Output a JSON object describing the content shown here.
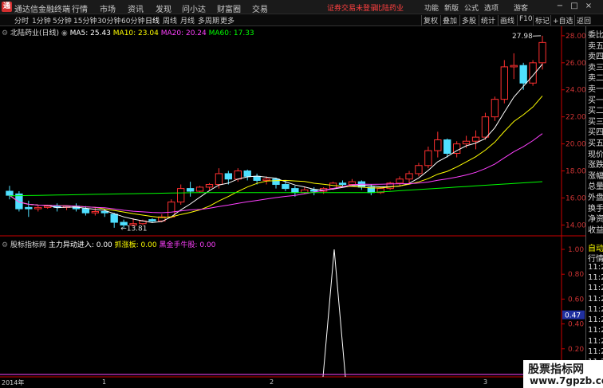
{
  "titlebar": {
    "logo": "通",
    "title": "通达信金融终端",
    "menus": [
      "行情",
      "市场",
      "资讯",
      "发现",
      "问小达",
      "财富圈",
      "交易"
    ],
    "notice": "证券交易未登录",
    "notice_stock": "北陆药业",
    "right_menus": [
      "功能",
      "新版",
      "公式",
      "选项"
    ],
    "user": "游客",
    "controls": [
      "−",
      "□",
      "×"
    ]
  },
  "toolbar": {
    "periods": [
      "分时",
      "1分钟",
      "5分钟",
      "15分钟",
      "30分钟",
      "60分钟",
      "日线",
      "周线",
      "月线",
      "多周期",
      "更多"
    ],
    "active_period": "日线",
    "buttons": [
      "复权",
      "叠加",
      "多股",
      "统计",
      "画线",
      "F10",
      "标记",
      "+自选",
      "返回"
    ]
  },
  "main": {
    "stock_label": "北陆药业(日线)",
    "ma5": "MA5: 25.43",
    "ma10": "MA10: 23.04",
    "ma20": "MA20: 20.24",
    "ma60": "MA60: 17.33",
    "high_label": "27.98",
    "low_label": "13.81"
  },
  "sub": {
    "indicator": "股标指标网",
    "line1": "主力异动进入: 0.00",
    "line2": "抓涨板: 0.00",
    "line3": "黑金手牛股: 0.00",
    "value_box": "0.47"
  },
  "right_panel": {
    "items": [
      "委比",
      "卖五",
      "卖四",
      "卖三",
      "卖二",
      "卖一",
      "买一",
      "买二",
      "买三",
      "买四",
      "买五",
      "现价",
      "涨跌",
      "涨幅",
      "总量",
      "外盘",
      "换手",
      "净资",
      "收益",
      "自动",
      "行情",
      "11:2",
      "11:2",
      "11:2",
      "11:2",
      "11:2",
      "11:2",
      "11:2",
      "11:2",
      "11:2",
      "11:2",
      "11:2",
      "11:2"
    ]
  },
  "chart_data": {
    "type": "candlestick",
    "price_axis": [
      "28.00",
      "26.00",
      "24.00",
      "22.00",
      "20.00",
      "18.00",
      "16.00",
      "14.00"
    ],
    "indicator_axis": [
      "1.00",
      "0.80",
      "0.60",
      "0.40",
      "0.20"
    ],
    "date_labels": [
      "2014年",
      "1",
      "2",
      "3"
    ],
    "colors": {
      "up": "#ff3030",
      "down": "#4fe0ff",
      "ma5": "#ffffff",
      "ma10": "#ffff00",
      "ma20": "#ff40ff",
      "ma60": "#00ff00"
    },
    "candles": [
      [
        16.5,
        16.9,
        16.2,
        15.9
      ],
      [
        16.3,
        16.5,
        15.2,
        15.0
      ],
      [
        15.3,
        15.8,
        15.2,
        14.6
      ],
      [
        15.2,
        15.5,
        15.3,
        15.0
      ],
      [
        15.3,
        15.5,
        15.4,
        15.2
      ],
      [
        15.4,
        15.6,
        15.3,
        15.0
      ],
      [
        15.3,
        15.4,
        15.4,
        15.1
      ],
      [
        15.4,
        15.6,
        15.2,
        15.0
      ],
      [
        15.2,
        15.4,
        14.9,
        14.7
      ],
      [
        14.9,
        15.3,
        15.0,
        14.7
      ],
      [
        15.0,
        15.2,
        14.9,
        14.6
      ],
      [
        14.8,
        14.9,
        14.2,
        13.8
      ],
      [
        14.2,
        14.4,
        14.0,
        13.8
      ],
      [
        14.0,
        14.5,
        14.1,
        13.9
      ],
      [
        14.1,
        14.4,
        14.3,
        14.0
      ],
      [
        14.4,
        14.5,
        14.3,
        14.2
      ],
      [
        14.3,
        14.8,
        14.6,
        14.2
      ],
      [
        14.6,
        15.9,
        15.7,
        14.5
      ],
      [
        15.7,
        17.0,
        16.7,
        15.5
      ],
      [
        16.7,
        17.2,
        16.5,
        16.1
      ],
      [
        16.5,
        16.9,
        16.8,
        16.4
      ],
      [
        16.8,
        17.1,
        17.0,
        16.6
      ],
      [
        17.0,
        18.2,
        17.8,
        16.7
      ],
      [
        17.8,
        18.0,
        17.4,
        17.0
      ],
      [
        17.4,
        18.2,
        18.0,
        17.2
      ],
      [
        18.0,
        18.1,
        17.6,
        17.3
      ],
      [
        17.6,
        17.8,
        17.3,
        17.0
      ],
      [
        17.3,
        17.6,
        17.4,
        17.0
      ],
      [
        17.4,
        17.5,
        17.0,
        16.7
      ],
      [
        17.0,
        17.3,
        16.7,
        16.5
      ],
      [
        16.7,
        16.9,
        16.4,
        16.1
      ],
      [
        16.4,
        16.8,
        16.6,
        16.3
      ],
      [
        16.6,
        16.8,
        16.5,
        16.2
      ],
      [
        16.5,
        16.8,
        16.7,
        16.3
      ],
      [
        16.7,
        17.2,
        17.1,
        16.6
      ],
      [
        17.1,
        17.3,
        17.0,
        16.8
      ],
      [
        17.0,
        17.4,
        17.2,
        16.9
      ],
      [
        17.2,
        17.3,
        16.8,
        16.6
      ],
      [
        16.8,
        17.0,
        16.4,
        16.2
      ],
      [
        16.4,
        16.8,
        16.7,
        16.3
      ],
      [
        16.7,
        17.2,
        17.1,
        16.6
      ],
      [
        17.1,
        17.6,
        17.4,
        16.9
      ],
      [
        17.4,
        18.0,
        17.8,
        17.1
      ],
      [
        17.8,
        18.6,
        18.4,
        17.6
      ],
      [
        18.4,
        19.8,
        19.5,
        18.2
      ],
      [
        19.5,
        20.9,
        20.3,
        19.0
      ],
      [
        20.3,
        20.4,
        19.3,
        19.0
      ],
      [
        19.3,
        20.2,
        20.0,
        19.0
      ],
      [
        20.0,
        20.6,
        20.2,
        19.7
      ],
      [
        20.2,
        21.0,
        20.5,
        19.6
      ],
      [
        20.5,
        22.3,
        22.0,
        20.3
      ],
      [
        22.0,
        23.5,
        23.3,
        21.7
      ],
      [
        23.3,
        26.2,
        25.7,
        23.0
      ],
      [
        25.7,
        26.7,
        25.8,
        24.8
      ],
      [
        25.8,
        26.0,
        24.5,
        24.0
      ],
      [
        24.5,
        26.2,
        26.0,
        24.3
      ],
      [
        26.0,
        28.0,
        27.5,
        25.5
      ]
    ],
    "spike_index": 37
  }
}
